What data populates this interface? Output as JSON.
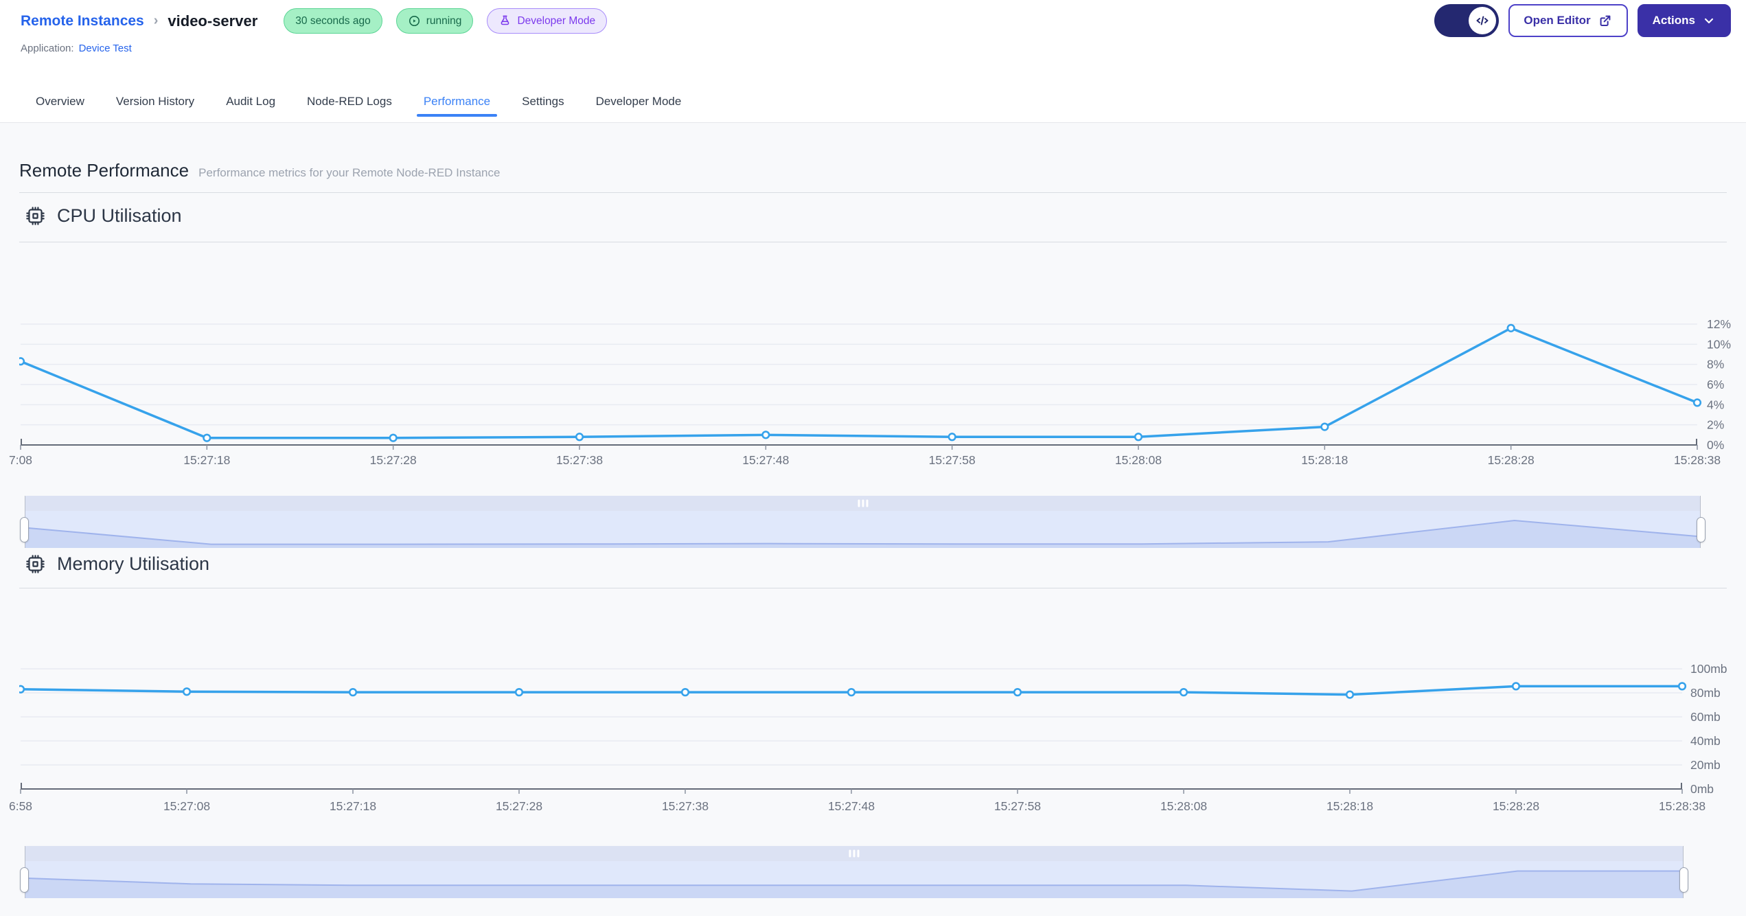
{
  "header": {
    "breadcrumb": {
      "root": "Remote Instances",
      "separator": "›",
      "current": "video-server"
    },
    "badges": {
      "last_seen": {
        "label": "30 seconds ago"
      },
      "status": {
        "label": "running",
        "icon": "play-circle-icon"
      },
      "mode": {
        "label": "Developer Mode",
        "icon": "flask-icon"
      }
    },
    "application": {
      "label": "Application:",
      "name": "Device Test"
    },
    "actions": {
      "open_editor": "Open Editor",
      "actions": "Actions"
    }
  },
  "tabs": [
    {
      "label": "Overview",
      "active": false
    },
    {
      "label": "Version History",
      "active": false
    },
    {
      "label": "Audit Log",
      "active": false
    },
    {
      "label": "Node-RED Logs",
      "active": false
    },
    {
      "label": "Performance",
      "active": true
    },
    {
      "label": "Settings",
      "active": false
    },
    {
      "label": "Developer Mode",
      "active": false
    }
  ],
  "page": {
    "title": "Remote Performance",
    "subtitle": "Performance metrics for your Remote Node-RED Instance"
  },
  "colors": {
    "link_blue": "#2563eb",
    "tab_active": "#3b82f6",
    "indigo_button": "#3a30a7",
    "toggle_pill": "#242870",
    "badge_green_bg": "#a5f0c5",
    "badge_purple_text": "#7c3aed",
    "chart_line": "#36a2eb",
    "axis_line": "#646b78",
    "axis_text": "#6b7280",
    "gridline": "#e8ebf2",
    "mini_line": "#9fb3ec",
    "mini_fill": "#cbd7f5"
  },
  "chart_data": [
    {
      "type": "line",
      "title": "CPU Utilisation",
      "icon": "cpu-chip-icon",
      "x": [
        "7:08",
        "15:27:18",
        "15:27:28",
        "15:27:38",
        "15:27:48",
        "15:27:58",
        "15:28:08",
        "15:28:18",
        "15:28:28",
        "15:28:38"
      ],
      "values": [
        8.3,
        0.7,
        0.7,
        0.8,
        1.0,
        0.8,
        0.8,
        1.8,
        11.6,
        4.2
      ],
      "unit": "%",
      "ylim": [
        0,
        12
      ],
      "ytick_labels": [
        "0%",
        "2%",
        "4%",
        "6%",
        "8%",
        "10%",
        "12%"
      ],
      "legend": "none",
      "grid": true
    },
    {
      "type": "line",
      "title": "Memory Utilisation",
      "icon": "cpu-chip-icon",
      "x": [
        "6:58",
        "15:27:08",
        "15:27:18",
        "15:27:28",
        "15:27:38",
        "15:27:48",
        "15:27:58",
        "15:28:08",
        "15:28:18",
        "15:28:28",
        "15:28:38"
      ],
      "values": [
        83,
        81,
        80.5,
        80.5,
        80.5,
        80.5,
        80.5,
        80.5,
        78.5,
        85.5,
        85.5
      ],
      "unit": "mb",
      "ylim": [
        0,
        100
      ],
      "ytick_labels": [
        "0mb",
        "20mb",
        "40mb",
        "60mb",
        "80mb",
        "100mb"
      ],
      "legend": "none",
      "grid": true
    }
  ]
}
